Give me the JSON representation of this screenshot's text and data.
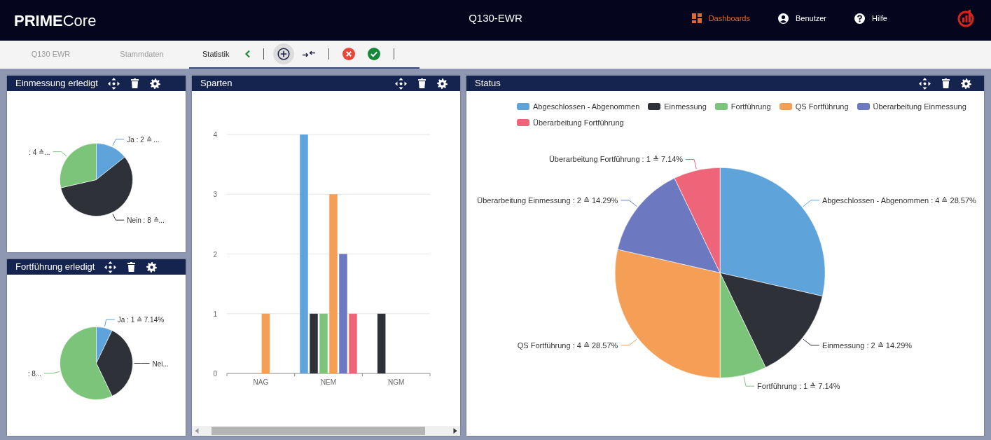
{
  "brand": {
    "bold": "PRIME",
    "rest": "Core"
  },
  "title": "Q130-EWR",
  "nav": [
    {
      "kind": "dashboard",
      "label": "Dashboards",
      "selected": true
    },
    {
      "kind": "user",
      "label": "Benutzer",
      "selected": false
    },
    {
      "kind": "help",
      "label": "Hilfe",
      "selected": false
    }
  ],
  "tabs": [
    {
      "label": "Q130 EWR",
      "selected": false
    },
    {
      "label": "Stammdaten",
      "selected": false
    },
    {
      "label": "Statistik",
      "selected": true
    }
  ],
  "toolbar": [
    {
      "kind": "back",
      "hovered": false
    },
    {
      "kind": "separator"
    },
    {
      "kind": "add",
      "hovered": true
    },
    {
      "kind": "collapse",
      "hovered": false
    },
    {
      "kind": "separator"
    },
    {
      "kind": "cancel",
      "hovered": false
    },
    {
      "kind": "confirm",
      "hovered": false
    },
    {
      "kind": "separator"
    }
  ],
  "panels": [
    {
      "title": "Einmessung erledigt",
      "chart_data": {
        "type": "pie",
        "values": [
          2,
          8,
          4
        ],
        "colors": [
          "#5fa3db",
          "#2e3138",
          "#7cc47a"
        ],
        "value_labels": [
          "Ja : 2 ≙ ...",
          "Nein : 8 ≙...",
          ": 4 ≙..."
        ]
      }
    },
    {
      "title": "Fortführung erledigt",
      "chart_data": {
        "type": "pie",
        "values": [
          1,
          5,
          8
        ],
        "colors": [
          "#5fa3db",
          "#2e3138",
          "#7cc47a"
        ],
        "value_labels": [
          "Ja : 1 ≙ 7.14%",
          "Nei...",
          ": 8..."
        ]
      }
    },
    {
      "title": "Sparten",
      "chart_data": {
        "type": "bar",
        "grid": true,
        "categories": [
          "NAG",
          "NEM",
          "NGM"
        ],
        "ylim": [
          0,
          4
        ],
        "yticks": [
          0,
          1,
          2,
          3,
          4
        ],
        "series": [
          {
            "color": "#5fa3db",
            "values": [
              0,
              4,
              0
            ]
          },
          {
            "color": "#2e3138",
            "values": [
              0,
              1,
              1
            ]
          },
          {
            "color": "#7cc47a",
            "values": [
              0,
              1,
              0
            ]
          },
          {
            "color": "#f59e55",
            "values": [
              1,
              3,
              0
            ]
          },
          {
            "color": "#6c79c1",
            "values": [
              0,
              2,
              0
            ]
          },
          {
            "color": "#ee6478",
            "values": [
              0,
              1,
              0
            ]
          }
        ]
      }
    },
    {
      "title": "Status",
      "chart_data": {
        "type": "pie",
        "legend": true,
        "categories": [
          "Abgeschlossen - Abgenommen",
          "Einmessung",
          "Fortführung",
          "QS Fortführung",
          "Überarbeitung Einmessung",
          "Überarbeitung Fortführung"
        ],
        "values": [
          4,
          2,
          1,
          4,
          2,
          1
        ],
        "colors": [
          "#5fa3db",
          "#2e3138",
          "#7cc47a",
          "#f59e55",
          "#6c79c1",
          "#ee6478"
        ],
        "value_labels": [
          "Abgeschlossen - Abgenommen : 4 ≙ 28.57%",
          "Einmessung : 2 ≙ 14.29%",
          "Fortführung : 1 ≙ 7.14%",
          "QS Fortführung : 4 ≙ 28.57%",
          "Überarbeitung Einmessung : 2 ≙ 14.29%",
          "Überarbeitung Fortführung : 1 ≙ 7.14%"
        ]
      }
    }
  ]
}
